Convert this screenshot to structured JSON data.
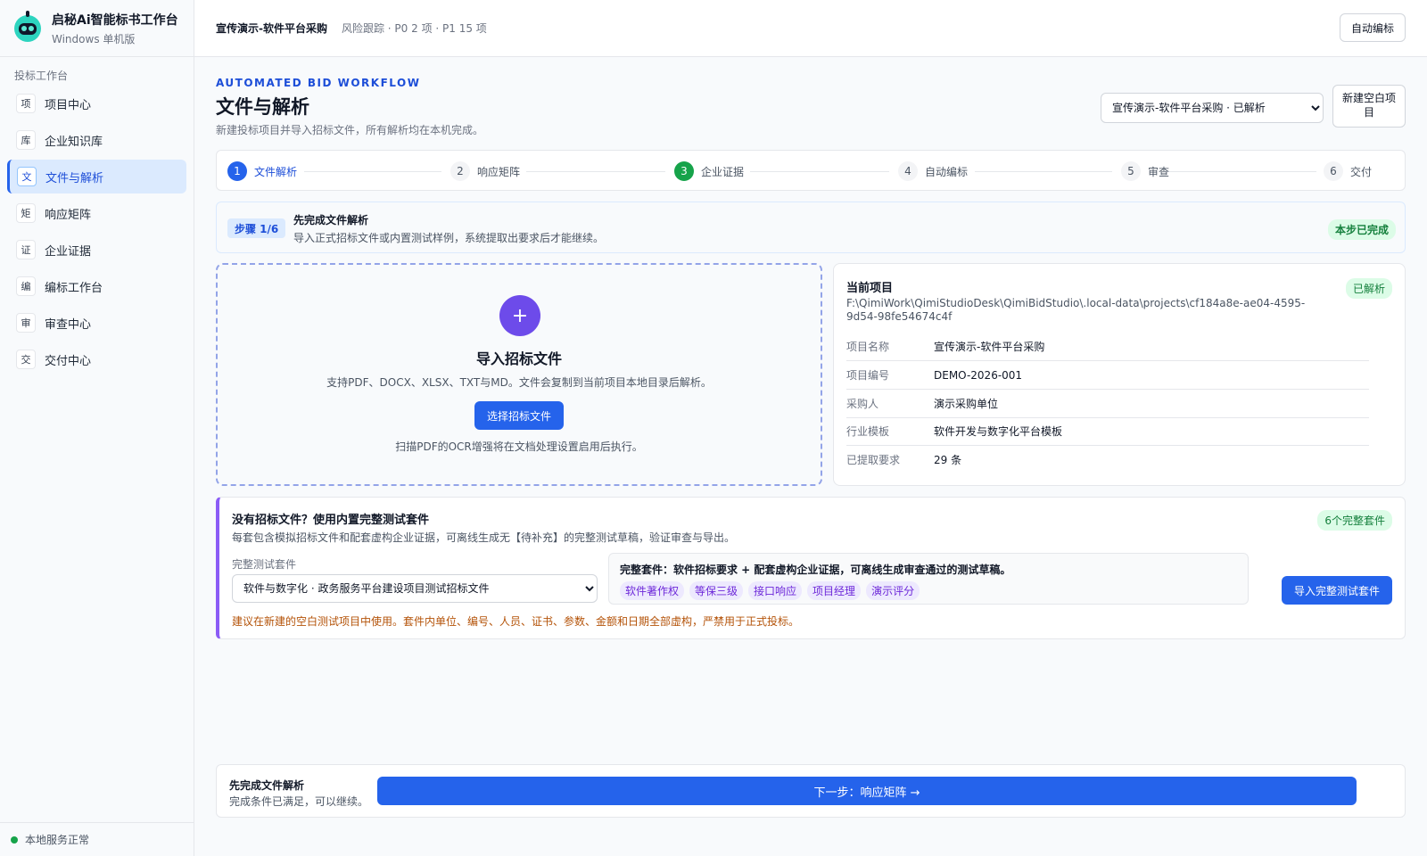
{
  "app": {
    "title": "启秘Ai智能标书工作台",
    "subtitle": "Windows 单机版"
  },
  "sidebar": {
    "group_label": "投标工作台",
    "items": [
      {
        "icon": "项",
        "label": "项目中心",
        "active": false
      },
      {
        "icon": "库",
        "label": "企业知识库",
        "active": false
      },
      {
        "icon": "文",
        "label": "文件与解析",
        "active": true
      },
      {
        "icon": "矩",
        "label": "响应矩阵",
        "active": false
      },
      {
        "icon": "证",
        "label": "企业证据",
        "active": false
      },
      {
        "icon": "编",
        "label": "编标工作台",
        "active": false
      },
      {
        "icon": "审",
        "label": "审查中心",
        "active": false
      },
      {
        "icon": "交",
        "label": "交付中心",
        "active": false
      }
    ],
    "footer_status": "本地服务正常"
  },
  "topbar": {
    "project_title": "宣传演示-软件平台采购",
    "risk_summary": "风险跟踪 · P0 2 项 · P1 15 项",
    "auto_button": "自动编标"
  },
  "page": {
    "eyebrow": "AUTOMATED BID WORKFLOW",
    "title": "文件与解析",
    "description": "新建投标项目并导入招标文件，所有解析均在本机完成。",
    "project_select_value": "宣传演示-软件平台采购 · 已解析",
    "new_button": "新建空白项目"
  },
  "steps": [
    {
      "num": "1",
      "label": "文件解析",
      "state": "current"
    },
    {
      "num": "2",
      "label": "响应矩阵",
      "state": "todo"
    },
    {
      "num": "3",
      "label": "企业证据",
      "state": "done"
    },
    {
      "num": "4",
      "label": "自动编标",
      "state": "todo"
    },
    {
      "num": "5",
      "label": "审查",
      "state": "todo"
    },
    {
      "num": "6",
      "label": "交付",
      "state": "todo"
    }
  ],
  "step_info": {
    "badge": "步骤 1/6",
    "title": "先完成文件解析",
    "description": "导入正式招标文件或内置测试样例，系统提取出要求后才能继续。",
    "status": "本步已完成"
  },
  "dropzone": {
    "plus_icon": "+",
    "title": "导入招标文件",
    "description": "支持PDF、DOCX、XLSX、TXT与MD。文件会复制到当前项目本地目录后解析。",
    "button": "选择招标文件",
    "note": "扫描PDF的OCR增强将在文档处理设置启用后执行。"
  },
  "current_project": {
    "title": "当前项目",
    "status": "已解析",
    "path": "F:\\QimiWork\\QimiStudioDesk\\QimiBidStudio\\.local-data\\projects\\cf184a8e-ae04-4595-9d54-98fe54674c4f",
    "fields": [
      {
        "label": "项目名称",
        "value": "宣传演示-软件平台采购"
      },
      {
        "label": "项目编号",
        "value": "DEMO-2026-001"
      },
      {
        "label": "采购人",
        "value": "演示采购单位"
      },
      {
        "label": "行业模板",
        "value": "软件开发与数字化平台模板"
      },
      {
        "label": "已提取要求",
        "value": "29 条"
      }
    ]
  },
  "test_suite": {
    "title": "没有招标文件？使用内置完整测试套件",
    "description": "每套包含模拟招标文件和配套虚构企业证据，可离线生成无【待补充】的完整测试草稿，验证审查与导出。",
    "count_badge": "6个完整套件",
    "select_label": "完整测试套件",
    "select_value": "软件与数字化 · 政务服务平台建设项目测试招标文件",
    "box_title": "完整套件：软件招标要求 + 配套虚构企业证据，可离线生成审查通过的测试草稿。",
    "tags": [
      "软件著作权",
      "等保三级",
      "接口响应",
      "项目经理",
      "演示评分"
    ],
    "import_button": "导入完整测试套件",
    "warning": "建议在新建的空白测试项目中使用。套件内单位、编号、人员、证书、参数、金额和日期全部虚构，严禁用于正式投标。"
  },
  "bottom_bar": {
    "title": "先完成文件解析",
    "subtitle": "完成条件已满足，可以继续。",
    "next_button": "下一步：响应矩阵 →"
  },
  "colors": {
    "accent": "#2563eb",
    "success": "#16a34a",
    "purple": "#8b5cf6",
    "warning": "#b45309"
  }
}
